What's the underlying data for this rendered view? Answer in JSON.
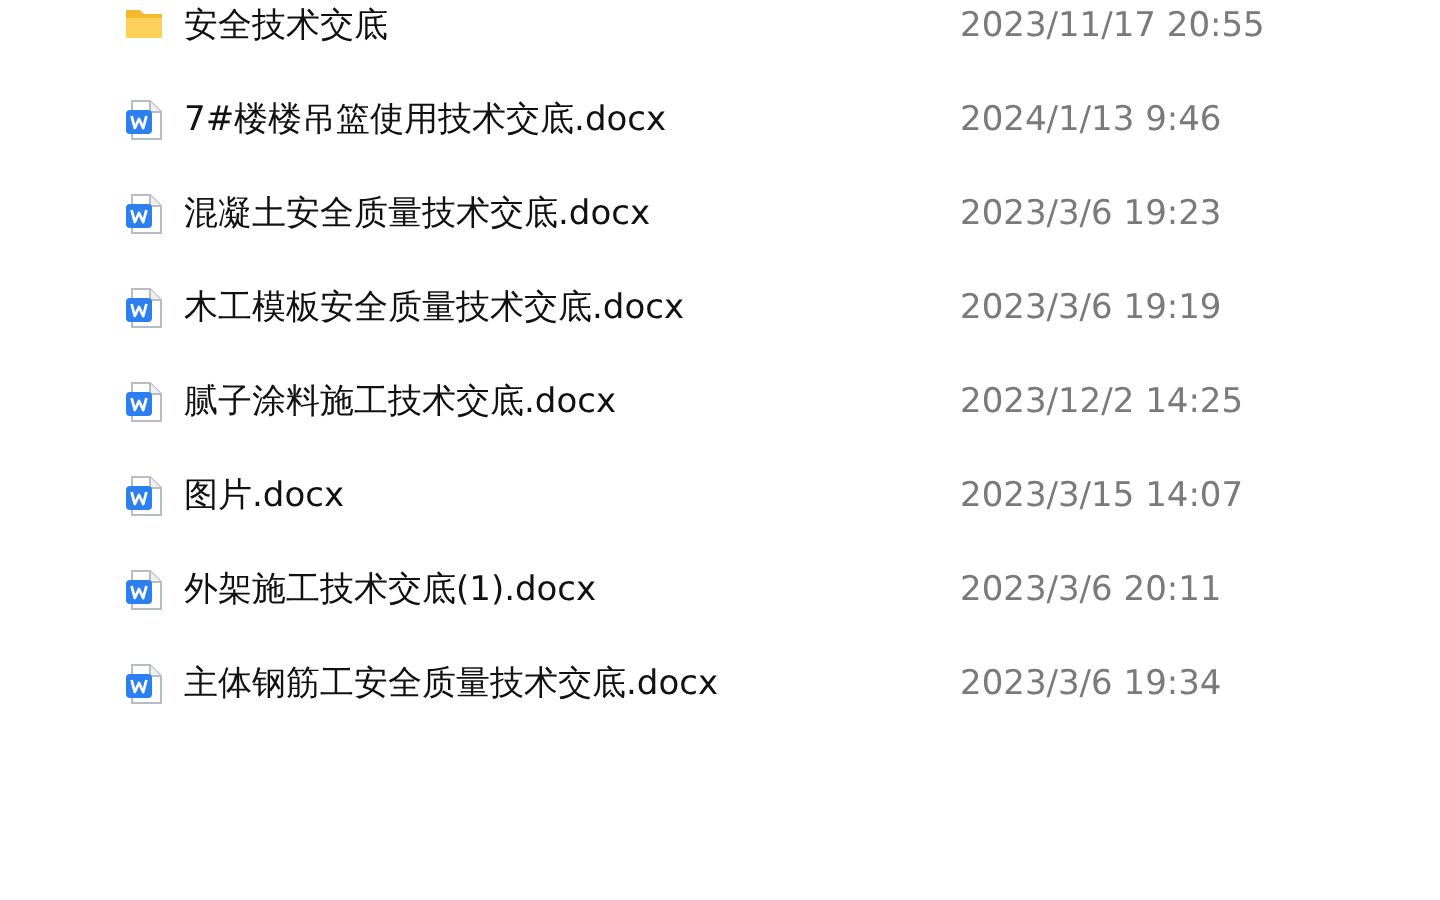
{
  "files": [
    {
      "kind": "folder",
      "name": "安全技术交底",
      "modified": "2023/11/17 20:55"
    },
    {
      "kind": "docx",
      "name": "7#楼楼吊篮使用技术交底.docx",
      "modified": "2024/1/13 9:46"
    },
    {
      "kind": "docx",
      "name": "混凝土安全质量技术交底.docx",
      "modified": "2023/3/6 19:23"
    },
    {
      "kind": "docx",
      "name": "木工模板安全质量技术交底.docx",
      "modified": "2023/3/6 19:19"
    },
    {
      "kind": "docx",
      "name": "腻子涂料施工技术交底.docx",
      "modified": "2023/12/2 14:25"
    },
    {
      "kind": "docx",
      "name": "图片.docx",
      "modified": "2023/3/15 14:07"
    },
    {
      "kind": "docx",
      "name": "外架施工技术交底(1).docx",
      "modified": "2023/3/6 20:11"
    },
    {
      "kind": "docx",
      "name": "主体钢筋工安全质量技术交底.docx",
      "modified": "2023/3/6 19:34"
    }
  ]
}
